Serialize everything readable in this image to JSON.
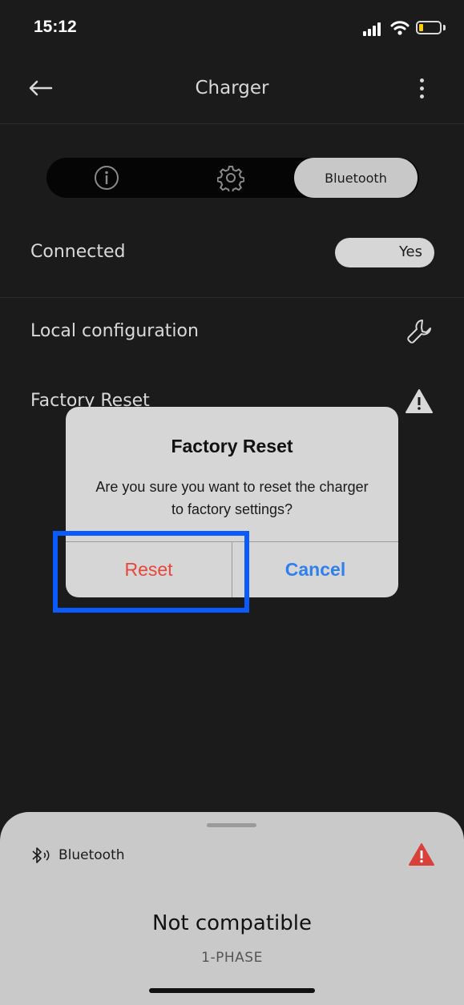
{
  "status_bar": {
    "time": "15:12"
  },
  "header": {
    "title": "Charger"
  },
  "tabs": {
    "bluetooth_label": "Bluetooth"
  },
  "rows": {
    "connected_label": "Connected",
    "connected_value": "Yes",
    "local_config_label": "Local configuration",
    "factory_reset_label": "Factory Reset"
  },
  "dialog": {
    "title": "Factory Reset",
    "message": "Are you sure you want to reset the charger to factory settings?",
    "reset_label": "Reset",
    "cancel_label": "Cancel"
  },
  "sheet": {
    "connection_label": "Bluetooth",
    "status": "Not compatible",
    "phase": "1-PHASE"
  },
  "colors": {
    "background": "#1b1b1b",
    "destructive": "#e8453c",
    "action": "#2f80ed",
    "highlight": "#0a5bff",
    "warning_red": "#d9403a"
  },
  "icons": [
    "back-arrow-icon",
    "more-vertical-icon",
    "info-icon",
    "gear-icon",
    "wrench-icon",
    "warning-icon",
    "bluetooth-icon"
  ]
}
